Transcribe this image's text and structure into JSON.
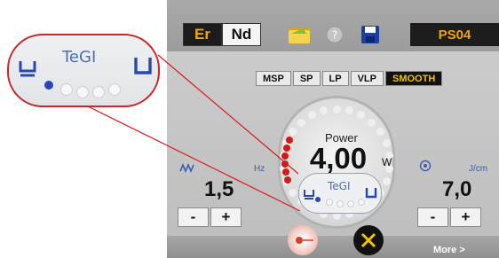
{
  "toolbar": {
    "mode_er": "Er",
    "mode_nd": "Nd",
    "ps_label": "PS04"
  },
  "modes": [
    "MSP",
    "SP",
    "LP",
    "VLP",
    "SMOOTH"
  ],
  "active_mode": "SMOOTH",
  "power": {
    "label": "Power",
    "value": "4,00",
    "unit": "W"
  },
  "frequency": {
    "unit": "Hz",
    "value": "1,5",
    "icon": "wave-icon"
  },
  "fluence": {
    "unit": "J/cm",
    "value": "7,0",
    "icon": "target-icon"
  },
  "stepper": {
    "minus": "-",
    "plus": "+"
  },
  "tegi": {
    "label": "TeGI"
  },
  "bottom": {
    "more_label": "More >"
  },
  "colors": {
    "accent": "#f0a500",
    "tegi_blue": "#2847b4",
    "highlight_red": "#c62828"
  }
}
